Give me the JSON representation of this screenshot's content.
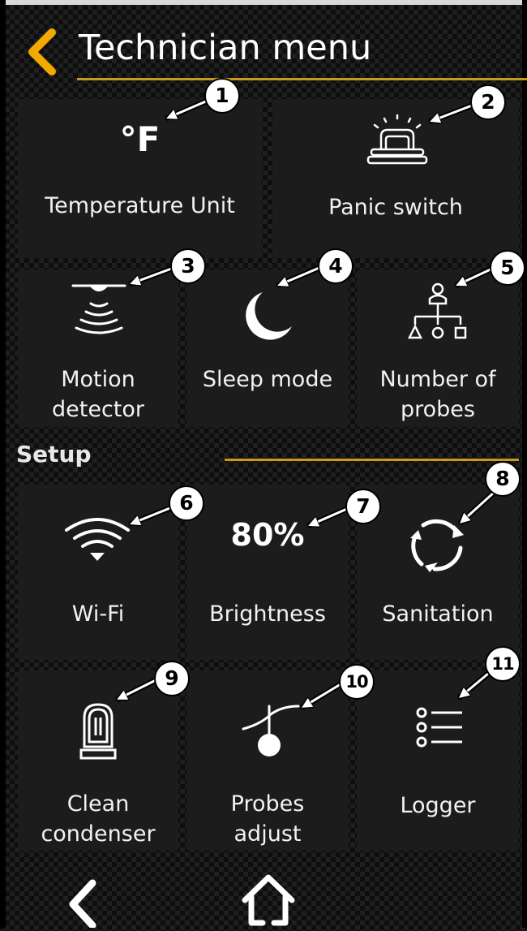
{
  "header": {
    "title": "Technician menu"
  },
  "tiles": [
    {
      "value": "°F",
      "label": "Temperature Unit",
      "badge": "1"
    },
    {
      "label": "Panic switch",
      "badge": "2",
      "icon": "panic-bell-icon"
    },
    {
      "label": "Motion detector",
      "label_line1": "Motion",
      "label_line2": "detector",
      "badge": "3",
      "icon": "motion-sensor-icon"
    },
    {
      "label": "Sleep mode",
      "badge": "4",
      "icon": "moon-icon"
    },
    {
      "label": "Number of probes",
      "label_line1": "Number of",
      "label_line2": "probes",
      "badge": "5",
      "icon": "probe-tree-icon"
    },
    {
      "label": "Wi-Fi",
      "badge": "6",
      "icon": "wifi-icon"
    },
    {
      "value": "80%",
      "label": "Brightness",
      "badge": "7"
    },
    {
      "label": "Sanitation",
      "badge": "8",
      "icon": "cycle-arrows-icon"
    },
    {
      "label": "Clean condenser",
      "label_line1": "Clean",
      "label_line2": "condenser",
      "badge": "9",
      "icon": "condenser-icon"
    },
    {
      "label": "Probes adjust",
      "label_line1": "Probes",
      "label_line2": "adjust",
      "badge": "10",
      "icon": "thermometer-adjust-icon"
    },
    {
      "label": "Logger",
      "badge": "11",
      "icon": "list-icon"
    }
  ],
  "section": {
    "setup_label": "Setup"
  },
  "colors": {
    "accent": "#f2a900",
    "divider": "#c89a1b",
    "tile": "#1c1c1c"
  },
  "icons": {
    "back": "chevron-left-icon",
    "home": "home-icon"
  }
}
